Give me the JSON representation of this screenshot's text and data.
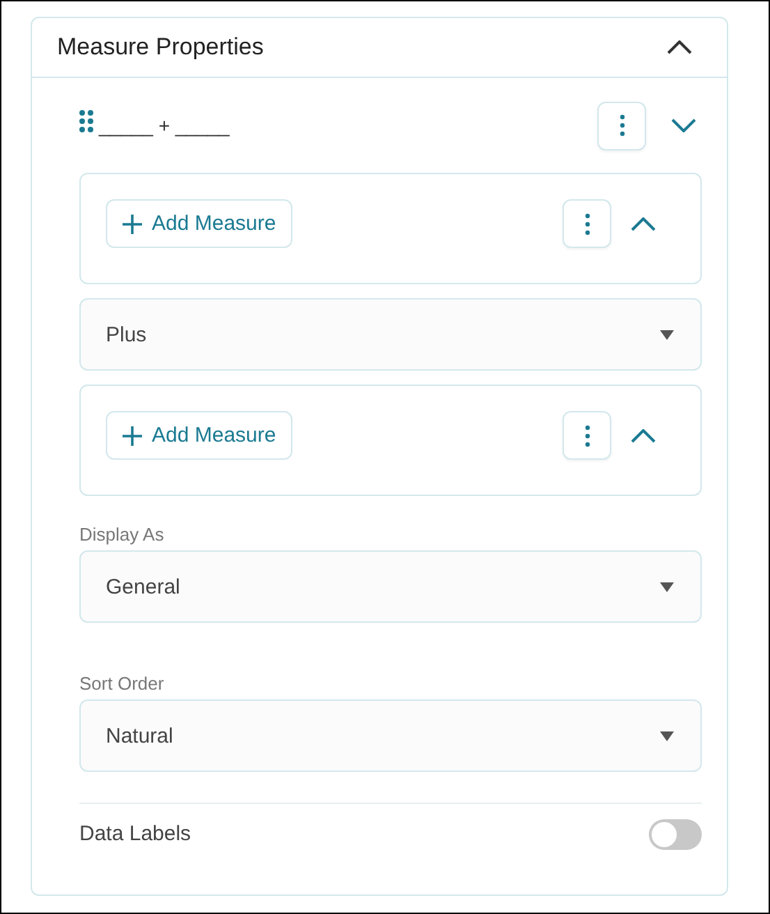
{
  "panel": {
    "title": "Measure Properties",
    "expanded": true
  },
  "formula": {
    "text": "_____ + _____",
    "expanded": false
  },
  "items": [
    {
      "kind": "measure",
      "button": "Add Measure",
      "expanded": true
    },
    {
      "kind": "select",
      "value": "Plus"
    },
    {
      "kind": "measure",
      "button": "Add Measure",
      "expanded": true
    }
  ],
  "fields": [
    {
      "label": "Display As",
      "value": "General"
    },
    {
      "label": "Sort Order",
      "value": "Natural"
    }
  ],
  "toggle": {
    "label": "Data Labels",
    "on": false
  }
}
